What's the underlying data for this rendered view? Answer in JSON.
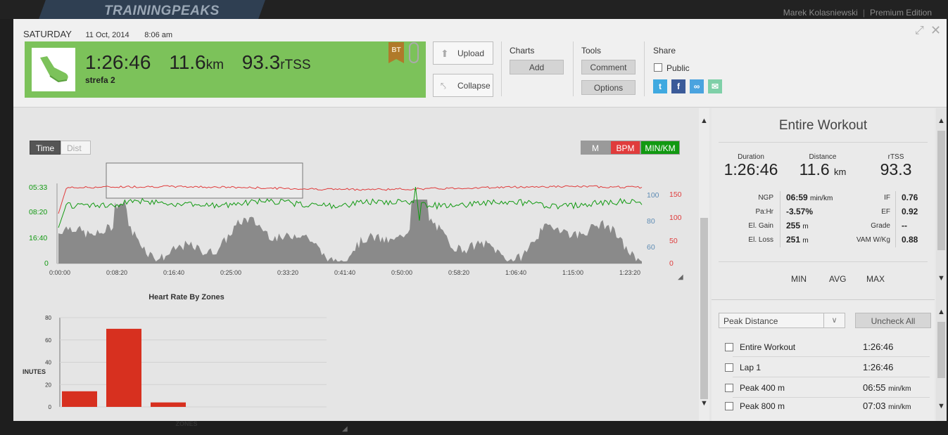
{
  "app": {
    "brand": "TRAININGPEAKS",
    "user": "Marek Kolasniewski",
    "edition": "Premium Edition"
  },
  "workout": {
    "day": "SATURDAY",
    "date": "11 Oct, 2014",
    "time": "8:06 am",
    "duration": "1:26:46",
    "distance": "11.6",
    "distance_unit": "km",
    "tss": "93.3",
    "tss_unit": "rTSS",
    "title": "strefa 2",
    "badge": "BT"
  },
  "toolbar": {
    "upload": "Upload",
    "collapse": "Collapse",
    "charts_label": "Charts",
    "add": "Add",
    "tools_label": "Tools",
    "comment": "Comment",
    "options": "Options",
    "share_label": "Share",
    "public": "Public",
    "social_icons": [
      "twitter-icon",
      "facebook-icon",
      "link-icon",
      "email-icon"
    ]
  },
  "graph": {
    "toggle_time": "Time",
    "toggle_dist": "Dist",
    "legend": [
      "M",
      "BPM",
      "MIN/KM"
    ],
    "legend_colors": [
      "#9a9a9a",
      "#e03c3c",
      "#119911"
    ],
    "pace_ticks": [
      "05:33",
      "08:20",
      "16:40",
      "0"
    ],
    "elev_ticks": [
      "100",
      "80",
      "60"
    ],
    "hr_ticks": [
      "150",
      "100",
      "50",
      "0"
    ],
    "x_ticks": [
      "0:00:00",
      "0:08:20",
      "0:16:40",
      "0:25:00",
      "0:33:20",
      "0:41:40",
      "0:50:00",
      "0:58:20",
      "1:06:40",
      "1:15:00",
      "1:23:20"
    ]
  },
  "chart_data": {
    "type": "bar",
    "title": "Heart Rate By Zones",
    "xlabel": "ZONES",
    "ylabel": "INUTES",
    "yticks": [
      "80",
      "60",
      "40",
      "20",
      "0"
    ],
    "ylim": [
      0,
      80
    ],
    "categories": [
      "",
      "",
      ""
    ],
    "values": [
      14,
      70,
      4
    ],
    "color": "#d7301f"
  },
  "summary": {
    "title": "Entire Workout",
    "duration_label": "Duration",
    "duration": "1:26:46",
    "distance_label": "Distance",
    "distance": "11.6",
    "distance_unit": "km",
    "rtss_label": "rTSS",
    "rtss": "93.3",
    "metrics_left": [
      {
        "label": "NGP",
        "value": "06:59",
        "unit": "min/km"
      },
      {
        "label": "Pa:Hr",
        "value": "-3.57%",
        "unit": ""
      },
      {
        "label": "El. Gain",
        "value": "255",
        "unit": "m"
      },
      {
        "label": "El. Loss",
        "value": "251",
        "unit": "m"
      }
    ],
    "metrics_right": [
      {
        "label": "IF",
        "value": "0.76"
      },
      {
        "label": "EF",
        "value": "0.92"
      },
      {
        "label": "Grade",
        "value": "--"
      },
      {
        "label": "VAM W/Kg",
        "value": "0.88"
      }
    ],
    "minmax_headers": [
      "MIN",
      "AVG",
      "MAX"
    ]
  },
  "peaks": {
    "dropdown": "Peak Distance",
    "uncheck_all": "Uncheck All",
    "rows": [
      {
        "name": "Entire Workout",
        "value": "1:26:46",
        "unit": ""
      },
      {
        "name": "Lap 1",
        "value": "1:26:46",
        "unit": ""
      },
      {
        "name": "Peak 400 m",
        "value": "06:55",
        "unit": "min/km"
      },
      {
        "name": "Peak 800 m",
        "value": "07:03",
        "unit": "min/km"
      }
    ]
  }
}
